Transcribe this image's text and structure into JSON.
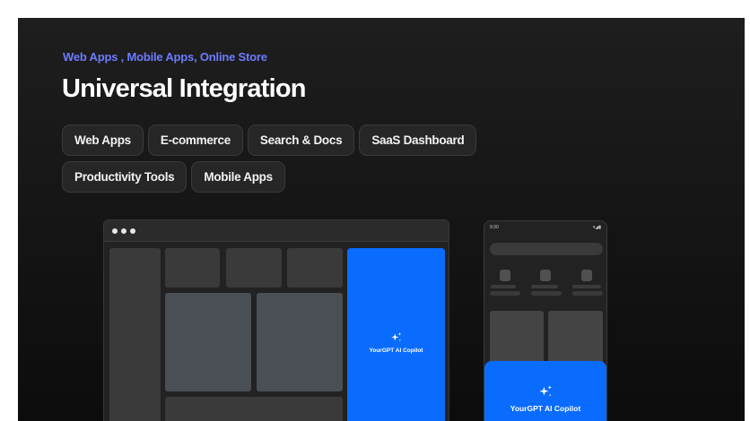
{
  "header": {
    "eyebrow": "Web Apps , Mobile Apps, Online Store",
    "title": "Universal Integration"
  },
  "chips": {
    "row1": [
      "Web Apps",
      "E-commerce",
      "Search & Docs",
      "SaaS Dashboard"
    ],
    "row2": [
      "Productivity Tools",
      "Mobile Apps"
    ]
  },
  "browser_mock": {
    "copilot_label": "YourGPT AI Copilot",
    "icon": "sparkle-icon"
  },
  "phone_mock": {
    "time": "9:30",
    "signal": "▾◢▮",
    "copilot_label": "YourGPT AI Copilot",
    "icon": "sparkle-icon"
  },
  "colors": {
    "accent": "#6d7bff",
    "copilot_blue": "#0a6cff",
    "background": "#141414"
  }
}
